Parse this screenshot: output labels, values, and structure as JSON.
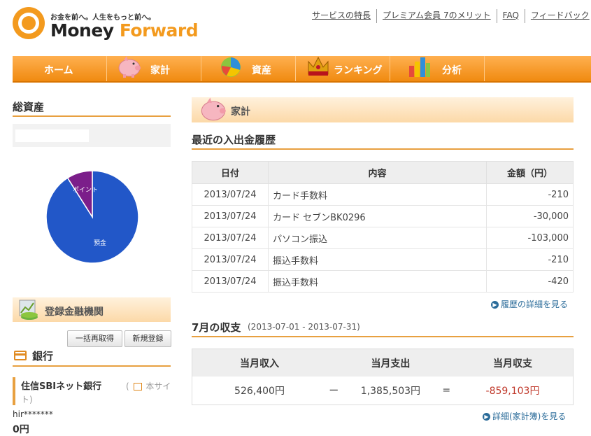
{
  "header": {
    "tagline": "お金を前へ。人生をもっと前へ。",
    "logo_money": "Money",
    "logo_forward": "Forward",
    "links": [
      "サービスの特長",
      "プレミアム会員 7のメリット",
      "FAQ",
      "フィードバック"
    ]
  },
  "nav": {
    "items": [
      {
        "label": "ホーム",
        "icon": "home"
      },
      {
        "label": "家計",
        "icon": "piggy-bank-icon"
      },
      {
        "label": "資産",
        "icon": "pie-chart-icon"
      },
      {
        "label": "ランキング",
        "icon": "crown-icon"
      },
      {
        "label": "分析",
        "icon": "bar-chart-icon"
      }
    ]
  },
  "sidebar": {
    "total_title": "総資産",
    "pie_labels": {
      "points": "ポイント",
      "deposit": "預金"
    },
    "banks_title": "登録金融機関",
    "refetch_button": "一括再取得",
    "new_button": "新規登録",
    "bank_section_title": "銀行",
    "bank_name": "住信SBIネット銀行",
    "bank_site_prefix": "(",
    "bank_site": "本サイ",
    "bank_site_end": "ト)",
    "bank_user": "hir*******",
    "bank_balance": "0円"
  },
  "chart_data": {
    "type": "pie",
    "slices": [
      {
        "label": "預金",
        "fraction": 0.91,
        "color": "#2257c8"
      },
      {
        "label": "ポイント",
        "fraction": 0.09,
        "color": "#7b1e8a"
      }
    ]
  },
  "main": {
    "section_title": "家計",
    "recent_title": "最近の入出金履歴",
    "columns": [
      "日付",
      "内容",
      "金額（円）"
    ],
    "rows": [
      {
        "date": "2013/07/24",
        "desc": "カード手数料",
        "amount": "-210"
      },
      {
        "date": "2013/07/24",
        "desc": "カード セブンBK0296",
        "amount": "-30,000"
      },
      {
        "date": "2013/07/24",
        "desc": "パソコン振込",
        "amount": "-103,000"
      },
      {
        "date": "2013/07/24",
        "desc": "振込手数料",
        "amount": "-210"
      },
      {
        "date": "2013/07/24",
        "desc": "振込手数料",
        "amount": "-420"
      }
    ],
    "history_link": "履歴の詳細を見る",
    "month_title": "7月の収支",
    "month_range": "(2013-07-01 - 2013-07-31)",
    "summary_headers": [
      "当月収入",
      "当月支出",
      "当月収支"
    ],
    "income": "526,400円",
    "minus_sign": "ー",
    "expense": "1,385,503円",
    "equals_sign": "=",
    "balance": "-859,103円",
    "detail_link": "詳細(家計簿)を見る"
  }
}
